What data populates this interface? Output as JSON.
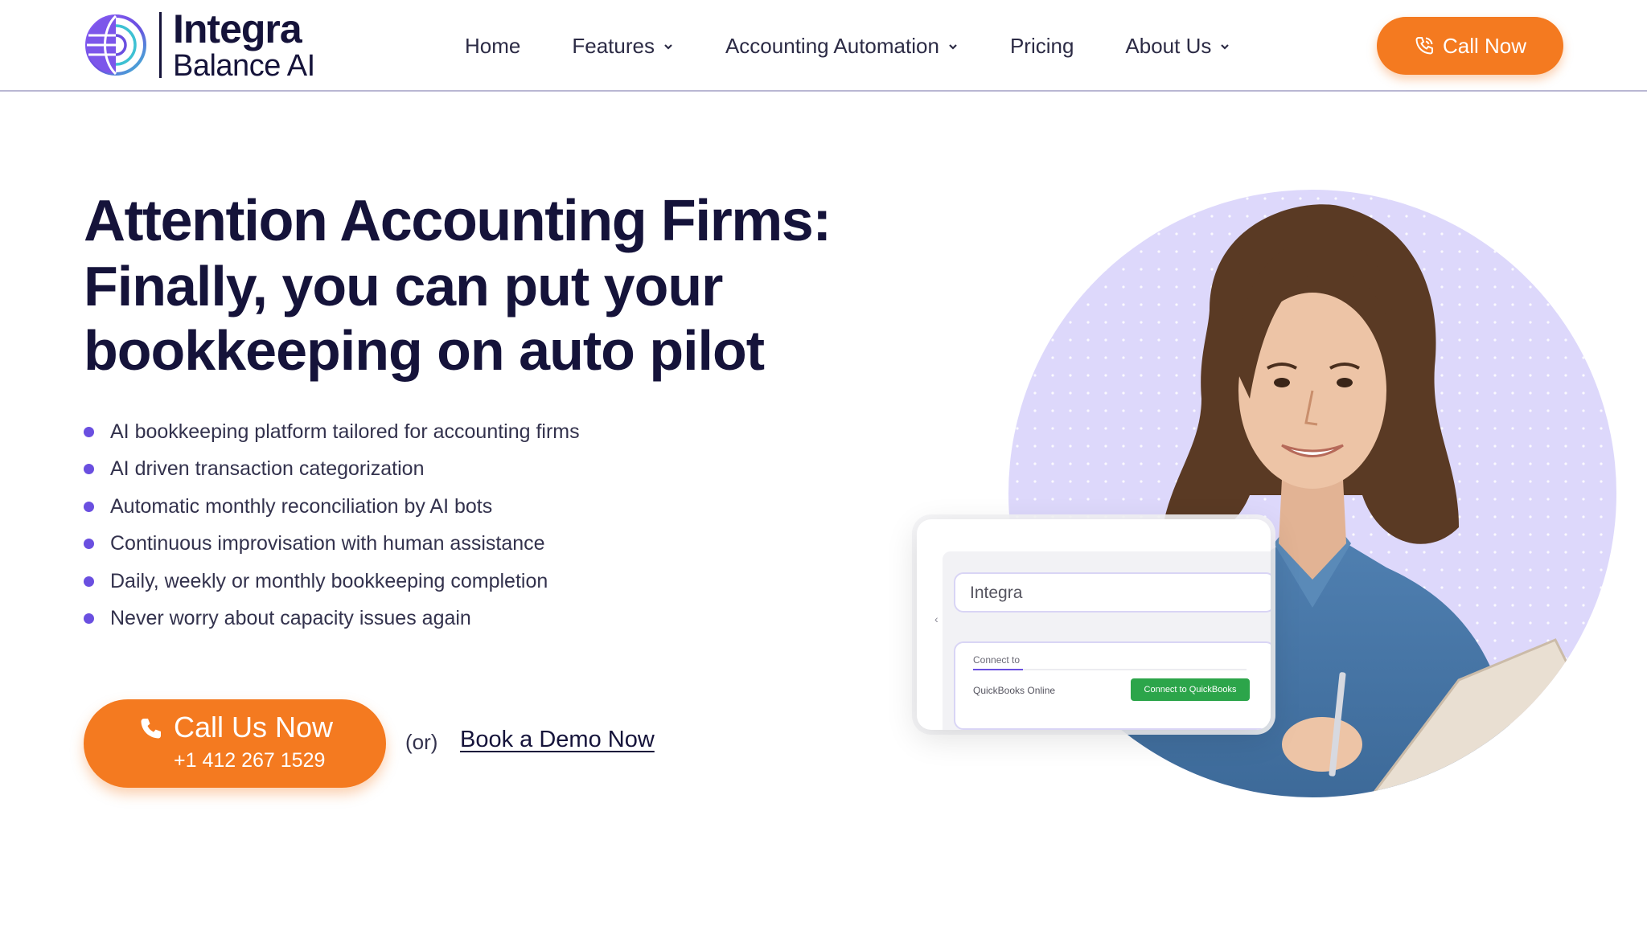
{
  "brand": {
    "name_line1": "Integra",
    "name_line2": "Balance AI",
    "logo_icon": "globe-logo-icon"
  },
  "nav": {
    "items": [
      {
        "label": "Home",
        "has_dropdown": false
      },
      {
        "label": "Features",
        "has_dropdown": true
      },
      {
        "label": "Accounting Automation",
        "has_dropdown": true
      },
      {
        "label": "Pricing",
        "has_dropdown": false
      },
      {
        "label": "About Us",
        "has_dropdown": true
      }
    ],
    "call_button": {
      "label": "Call Now",
      "icon": "phone-call-icon"
    }
  },
  "hero": {
    "title": "Attention Accounting Firms:",
    "subtitle": "Finally, you can put your bookkeeping on auto pilot",
    "bullets": [
      "AI bookkeeping platform tailored for accounting firms",
      "AI driven transaction categorization",
      "Automatic monthly reconciliation by AI bots",
      "Continuous improvisation with human assistance",
      "Daily, weekly or monthly bookkeeping completion",
      "Never worry about capacity issues again"
    ],
    "cta": {
      "label": "Call Us Now",
      "phone": "+1 412 267 1529",
      "icon": "phone-icon"
    },
    "or_text": "(or)",
    "demo_link": "Book a Demo Now"
  },
  "app_card": {
    "field_text": "Integra",
    "connect_label": "Connect to",
    "service_name": "QuickBooks Online",
    "connect_button": "Connect to QuickBooks"
  },
  "colors": {
    "accent_orange": "#f47a20",
    "brand_navy": "#15133a",
    "bullet_purple": "#6a4fe0",
    "circle_lavender": "#ddd8fb",
    "button_green": "#2ca54a"
  }
}
